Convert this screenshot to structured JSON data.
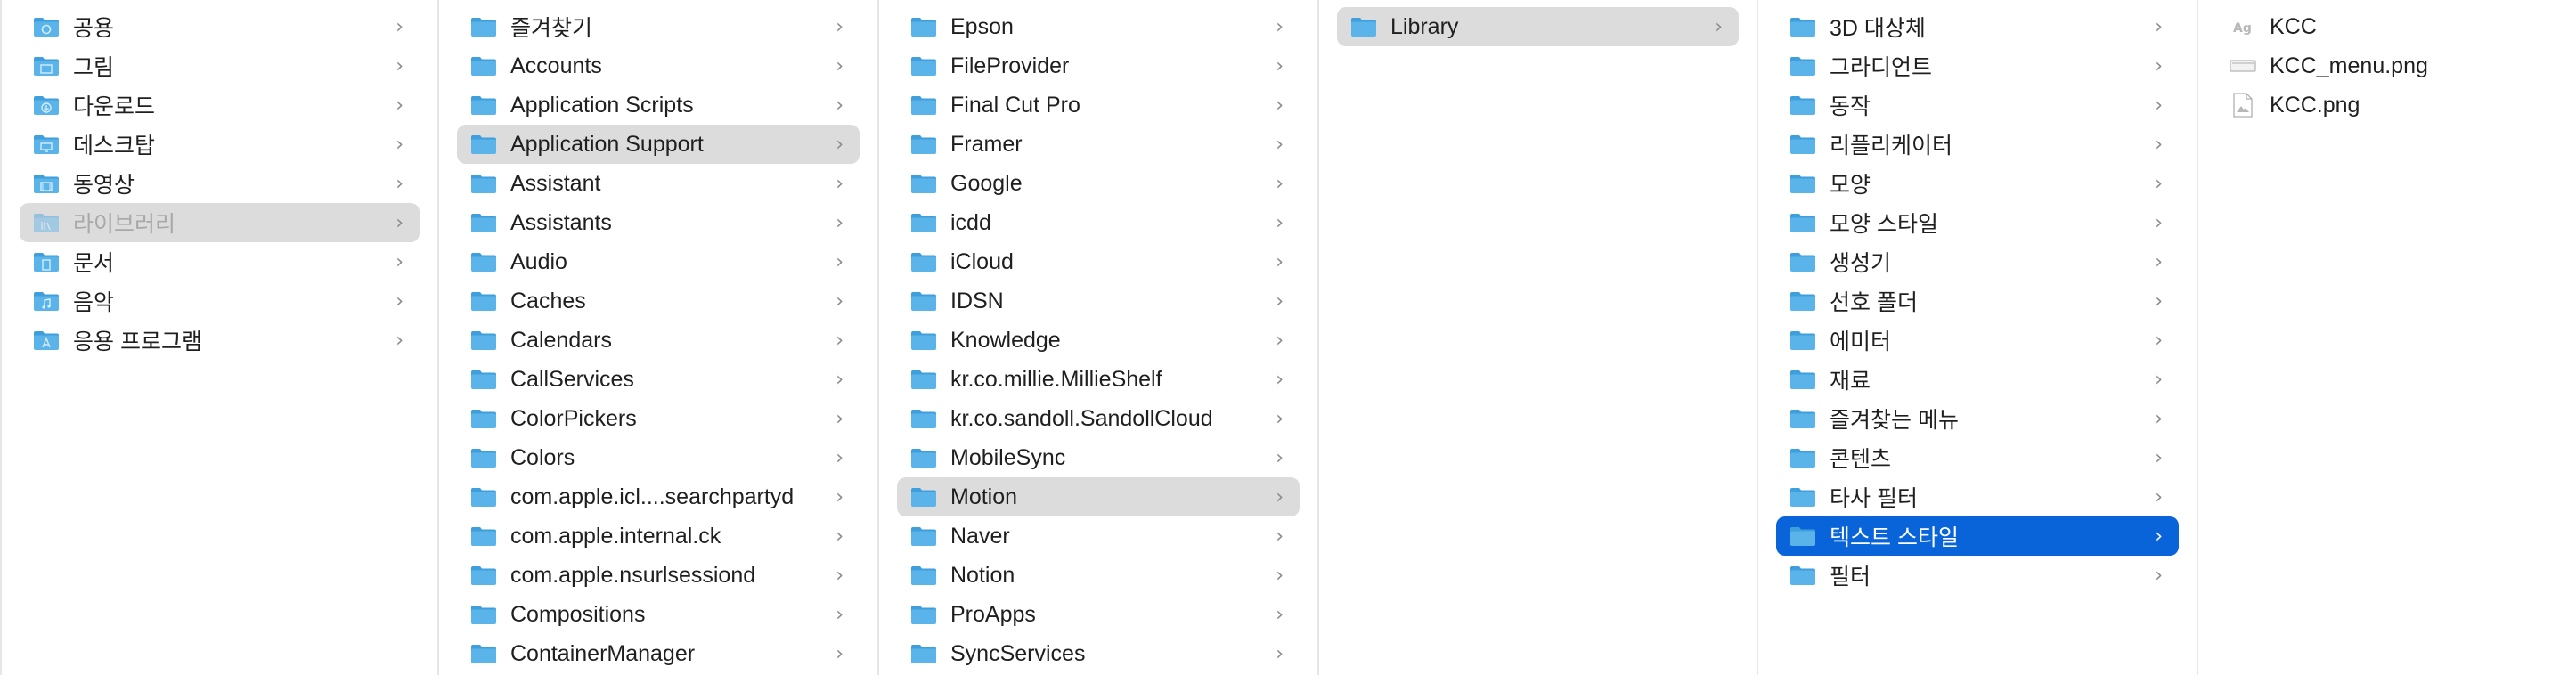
{
  "colors": {
    "folder": "#5ab4ea",
    "folder_tab": "#3f9fdc",
    "selection_gray": "#dcdcdc",
    "selection_blue": "#0a64d9",
    "chevron": "#8a8a8a"
  },
  "columns": [
    {
      "items": [
        {
          "label": "공용",
          "icon": "public-folder-icon",
          "selected": "none",
          "dim": false,
          "chevron": "›"
        },
        {
          "label": "그림",
          "icon": "pictures-folder-icon",
          "selected": "none",
          "dim": false,
          "chevron": "›"
        },
        {
          "label": "다운로드",
          "icon": "downloads-folder-icon",
          "selected": "none",
          "dim": false,
          "chevron": "›"
        },
        {
          "label": "데스크탑",
          "icon": "desktop-folder-icon",
          "selected": "none",
          "dim": false,
          "chevron": "›"
        },
        {
          "label": "동영상",
          "icon": "movies-folder-icon",
          "selected": "none",
          "dim": false,
          "chevron": "›"
        },
        {
          "label": "라이브러리",
          "icon": "library-folder-icon",
          "selected": "gray",
          "dim": true,
          "chevron": "›"
        },
        {
          "label": "문서",
          "icon": "documents-folder-icon",
          "selected": "none",
          "dim": false,
          "chevron": "›"
        },
        {
          "label": "음악",
          "icon": "music-folder-icon",
          "selected": "none",
          "dim": false,
          "chevron": "›"
        },
        {
          "label": "응용 프로그램",
          "icon": "applications-folder-icon",
          "selected": "none",
          "dim": false,
          "chevron": "›"
        }
      ]
    },
    {
      "items": [
        {
          "label": "즐겨찾기",
          "icon": "folder-icon",
          "selected": "none",
          "chevron": "›"
        },
        {
          "label": "Accounts",
          "icon": "folder-icon",
          "selected": "none",
          "chevron": "›"
        },
        {
          "label": "Application Scripts",
          "icon": "folder-icon",
          "selected": "none",
          "chevron": "›"
        },
        {
          "label": "Application Support",
          "icon": "folder-icon",
          "selected": "gray",
          "chevron": "›"
        },
        {
          "label": "Assistant",
          "icon": "folder-icon",
          "selected": "none",
          "chevron": "›"
        },
        {
          "label": "Assistants",
          "icon": "folder-icon",
          "selected": "none",
          "chevron": "›"
        },
        {
          "label": "Audio",
          "icon": "folder-icon",
          "selected": "none",
          "chevron": "›"
        },
        {
          "label": "Caches",
          "icon": "folder-icon",
          "selected": "none",
          "chevron": "›"
        },
        {
          "label": "Calendars",
          "icon": "folder-icon",
          "selected": "none",
          "chevron": "›"
        },
        {
          "label": "CallServices",
          "icon": "folder-icon",
          "selected": "none",
          "chevron": "›"
        },
        {
          "label": "ColorPickers",
          "icon": "folder-icon",
          "selected": "none",
          "chevron": "›"
        },
        {
          "label": "Colors",
          "icon": "folder-icon",
          "selected": "none",
          "chevron": "›"
        },
        {
          "label": "com.apple.icl....searchpartyd",
          "icon": "folder-icon",
          "selected": "none",
          "chevron": "›"
        },
        {
          "label": "com.apple.internal.ck",
          "icon": "folder-icon",
          "selected": "none",
          "chevron": "›"
        },
        {
          "label": "com.apple.nsurlsessiond",
          "icon": "folder-icon",
          "selected": "none",
          "chevron": "›"
        },
        {
          "label": "Compositions",
          "icon": "folder-icon",
          "selected": "none",
          "chevron": "›"
        },
        {
          "label": "ContainerManager",
          "icon": "folder-icon",
          "selected": "none",
          "chevron": "›"
        }
      ]
    },
    {
      "items": [
        {
          "label": "Epson",
          "icon": "folder-icon",
          "selected": "none",
          "chevron": "›"
        },
        {
          "label": "FileProvider",
          "icon": "folder-icon",
          "selected": "none",
          "chevron": "›"
        },
        {
          "label": "Final Cut Pro",
          "icon": "folder-icon",
          "selected": "none",
          "chevron": "›"
        },
        {
          "label": "Framer",
          "icon": "folder-icon",
          "selected": "none",
          "chevron": "›"
        },
        {
          "label": "Google",
          "icon": "folder-icon",
          "selected": "none",
          "chevron": "›"
        },
        {
          "label": "icdd",
          "icon": "folder-icon",
          "selected": "none",
          "chevron": "›"
        },
        {
          "label": "iCloud",
          "icon": "folder-icon",
          "selected": "none",
          "chevron": "›"
        },
        {
          "label": "IDSN",
          "icon": "folder-icon",
          "selected": "none",
          "chevron": "›"
        },
        {
          "label": "Knowledge",
          "icon": "folder-icon",
          "selected": "none",
          "chevron": "›"
        },
        {
          "label": "kr.co.millie.MillieShelf",
          "icon": "folder-icon",
          "selected": "none",
          "chevron": "›"
        },
        {
          "label": "kr.co.sandoll.SandollCloud",
          "icon": "folder-icon",
          "selected": "none",
          "chevron": "›"
        },
        {
          "label": "MobileSync",
          "icon": "folder-icon",
          "selected": "none",
          "chevron": "›"
        },
        {
          "label": "Motion",
          "icon": "folder-icon",
          "selected": "gray",
          "chevron": "›"
        },
        {
          "label": "Naver",
          "icon": "folder-icon",
          "selected": "none",
          "chevron": "›"
        },
        {
          "label": "Notion",
          "icon": "folder-icon",
          "selected": "none",
          "chevron": "›"
        },
        {
          "label": "ProApps",
          "icon": "folder-icon",
          "selected": "none",
          "chevron": "›"
        },
        {
          "label": "SyncServices",
          "icon": "folder-icon",
          "selected": "none",
          "chevron": "›"
        }
      ]
    },
    {
      "items": [
        {
          "label": "Library",
          "icon": "folder-icon",
          "selected": "gray",
          "chevron": "›"
        }
      ]
    },
    {
      "items": [
        {
          "label": "3D 대상체",
          "icon": "folder-icon",
          "selected": "none",
          "chevron": "›"
        },
        {
          "label": "그라디언트",
          "icon": "folder-icon",
          "selected": "none",
          "chevron": "›"
        },
        {
          "label": "동작",
          "icon": "folder-icon",
          "selected": "none",
          "chevron": "›"
        },
        {
          "label": "리플리케이터",
          "icon": "folder-icon",
          "selected": "none",
          "chevron": "›"
        },
        {
          "label": "모양",
          "icon": "folder-icon",
          "selected": "none",
          "chevron": "›"
        },
        {
          "label": "모양 스타일",
          "icon": "folder-icon",
          "selected": "none",
          "chevron": "›"
        },
        {
          "label": "생성기",
          "icon": "folder-icon",
          "selected": "none",
          "chevron": "›"
        },
        {
          "label": "선호 폴더",
          "icon": "folder-icon",
          "selected": "none",
          "chevron": "›"
        },
        {
          "label": "에미터",
          "icon": "folder-icon",
          "selected": "none",
          "chevron": "›"
        },
        {
          "label": "재료",
          "icon": "folder-icon",
          "selected": "none",
          "chevron": "›"
        },
        {
          "label": "즐겨찾는 메뉴",
          "icon": "folder-icon",
          "selected": "none",
          "chevron": "›"
        },
        {
          "label": "콘텐츠",
          "icon": "folder-icon",
          "selected": "none",
          "chevron": "›"
        },
        {
          "label": "타사 필터",
          "icon": "folder-icon",
          "selected": "none",
          "chevron": "›"
        },
        {
          "label": "텍스트 스타일",
          "icon": "folder-icon",
          "selected": "blue",
          "chevron": "›"
        },
        {
          "label": "필터",
          "icon": "folder-icon",
          "selected": "none",
          "chevron": "›"
        }
      ]
    },
    {
      "items": [
        {
          "label": "KCC",
          "icon": "text-style-file-icon",
          "selected": "none",
          "chevron": ""
        },
        {
          "label": "KCC_menu.png",
          "icon": "png-file-icon",
          "selected": "none",
          "chevron": ""
        },
        {
          "label": "KCC.png",
          "icon": "image-file-icon",
          "selected": "none",
          "chevron": ""
        }
      ]
    }
  ]
}
